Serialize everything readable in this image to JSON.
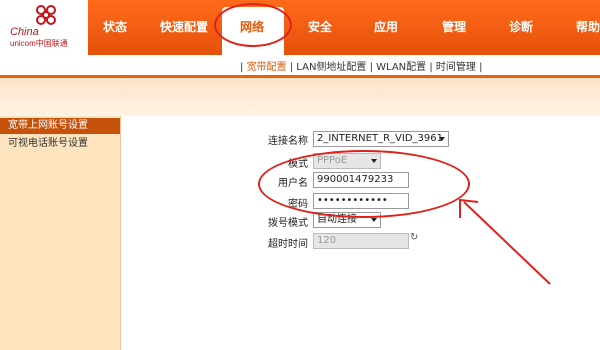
{
  "logo": {
    "line1": "China",
    "line2": "unicom中国联通",
    "brand_color": "#c4141a"
  },
  "nav": {
    "items": [
      "状态",
      "快速配置",
      "网络",
      "安全",
      "应用",
      "管理",
      "诊断",
      "帮助"
    ],
    "active": "网络"
  },
  "subnav": {
    "items": [
      "宽带配置",
      "LAN侧地址配置",
      "WLAN配置",
      "时间管理"
    ],
    "active": "宽带配置"
  },
  "sidebar": {
    "items": [
      "宽带上网账号设置",
      "可视电话账号设置"
    ],
    "active": "宽带上网账号设置"
  },
  "form": {
    "connection_name": {
      "label": "连接名称",
      "value": "2_INTERNET_R_VID_3961"
    },
    "mode": {
      "label": "模式",
      "value": "PPPoE"
    },
    "username": {
      "label": "用户名",
      "value": "990001479233"
    },
    "password": {
      "label": "密码",
      "value": "••••••••••••"
    },
    "dial_mode": {
      "label": "拨号模式",
      "value": "自动连接"
    },
    "timeout": {
      "label": "超时时间",
      "value": "120"
    }
  },
  "colors": {
    "header": "#e5510b",
    "highlight": "#e0221c",
    "sidebar_active": "#c6510b"
  }
}
